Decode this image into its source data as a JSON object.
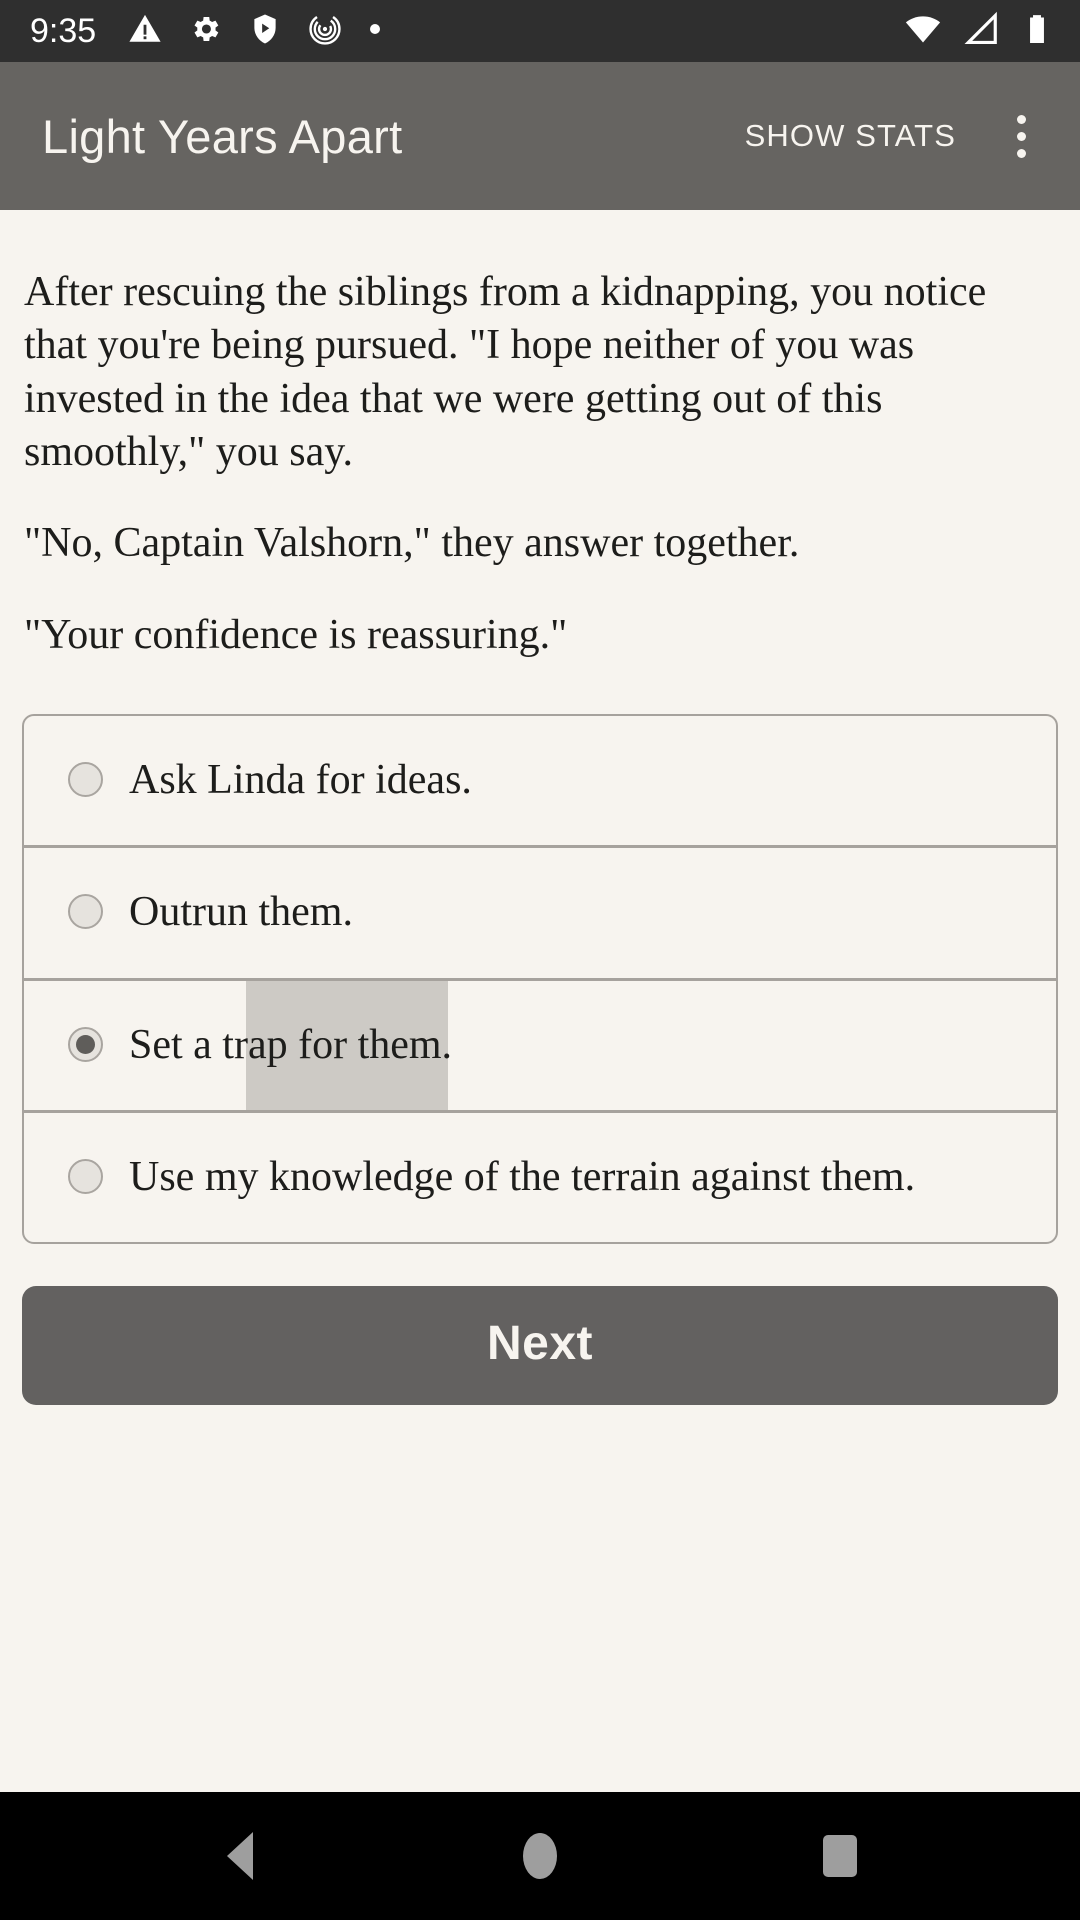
{
  "status_bar": {
    "clock": "9:35",
    "left_icons": [
      "warning-triangle-icon",
      "gear-icon",
      "shield-play-icon",
      "labyrinth-icon",
      "dot-icon"
    ],
    "right_icons": [
      "wifi-icon",
      "cellular-signal-icon",
      "battery-icon"
    ]
  },
  "app_bar": {
    "title": "Light Years Apart",
    "show_stats_label": "SHOW STATS",
    "overflow_icon": "more-vertical-icon",
    "background_color": "#666461",
    "text_color": "#f7f4ef"
  },
  "story": {
    "paragraphs": [
      "After rescuing the siblings from a kidnapping, you notice that you're being pursued. \"I hope neither of you was invested in the idea that we were getting out of this smoothly,\" you say.",
      "\"No, Captain Valshorn,\" they answer together.",
      "\"Your confidence is reassuring.\""
    ]
  },
  "choices": {
    "options": [
      {
        "label": "Ask Linda for ideas.",
        "selected": false
      },
      {
        "label": "Outrun them.",
        "selected": false
      },
      {
        "label": "Set a trap for them.",
        "selected": true
      },
      {
        "label": "Use my knowledge of the terrain against them.",
        "selected": false
      }
    ],
    "selected_index": 2,
    "border_color": "#a6a29d",
    "ripple_color": "#cdcac5"
  },
  "next_button": {
    "label": "Next",
    "background_color": "#636160",
    "text_color": "#f7f4ef"
  },
  "nav_bar": {
    "back_icon": "back-triangle-icon",
    "home_icon": "home-circle-icon",
    "recents_icon": "recents-square-icon"
  },
  "theme": {
    "page_background": "#f7f4ef",
    "body_text_color": "#1d1d1b",
    "status_bar_background": "#2f2f2f"
  }
}
